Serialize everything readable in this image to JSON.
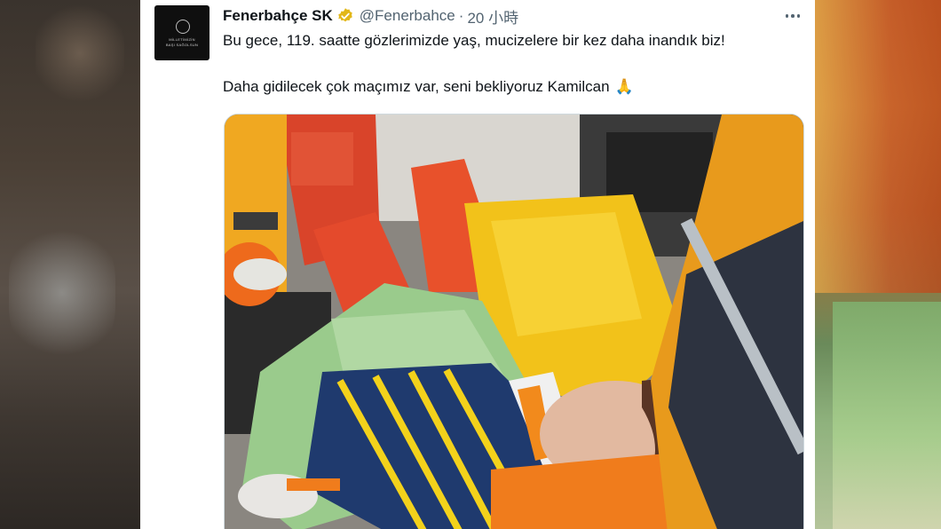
{
  "tweet": {
    "display_name": "Fenerbahçe SK",
    "handle": "@Fenerbahce",
    "separator": "·",
    "time": "20 小時",
    "text_line1": "Bu gece, 119. saatte gözlerimizde yaş, mucizelere bir kez daha inandık biz!",
    "text_line2": "Daha gidilecek çok maçımız var, seni bekliyoruz Kamilcan",
    "emoji": "🙏"
  },
  "avatar": {
    "caption_line1": "MİLLETİMİZİN",
    "caption_line2": "BAŞI SAĞOLSUN"
  },
  "icons": {
    "verified": "verified-badge-icon",
    "more": "more-options-icon"
  },
  "colors": {
    "verified_gold": "#e2b719",
    "text_primary": "#0f1419",
    "text_secondary": "#536471"
  }
}
